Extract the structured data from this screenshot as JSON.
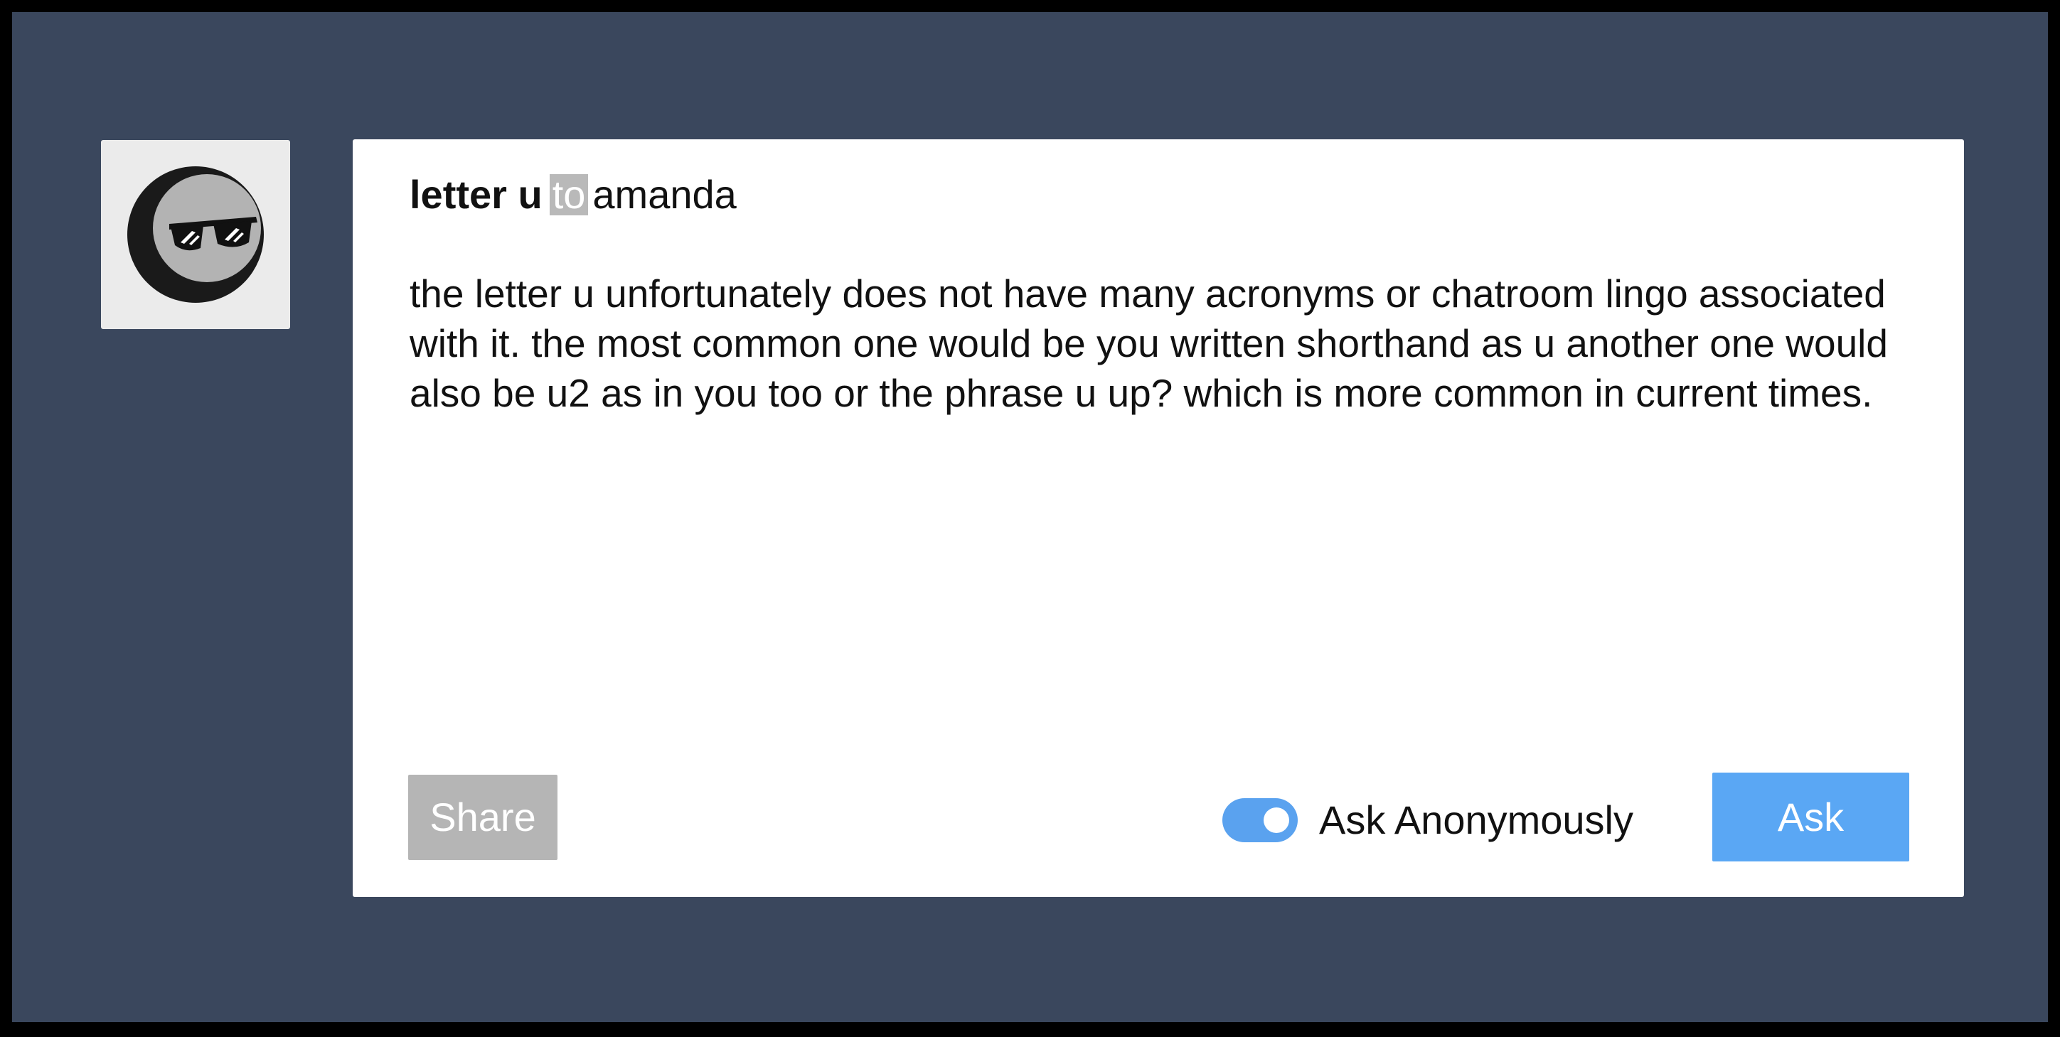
{
  "asker": {
    "avatar_icon": "sunglasses-moon-avatar-icon"
  },
  "card": {
    "sender_name": "letter u",
    "to_label": "to",
    "recipient_name": "amanda",
    "message": "the letter u unfortunately does not have many acronyms or chatroom lingo associated with it. the most common one would be you written shorthand as u another one would also be u2 as in you too or the phrase u up? which is more common in current times."
  },
  "actions": {
    "share_label": "Share",
    "anonymous_label": "Ask Anonymously",
    "anonymous_enabled": true,
    "ask_label": "Ask"
  },
  "colors": {
    "background": "#3a475d",
    "frame": "#000000",
    "accent": "#5aa7f4",
    "share": "#b5b5b5",
    "to_chip": "#b9b9b9"
  }
}
